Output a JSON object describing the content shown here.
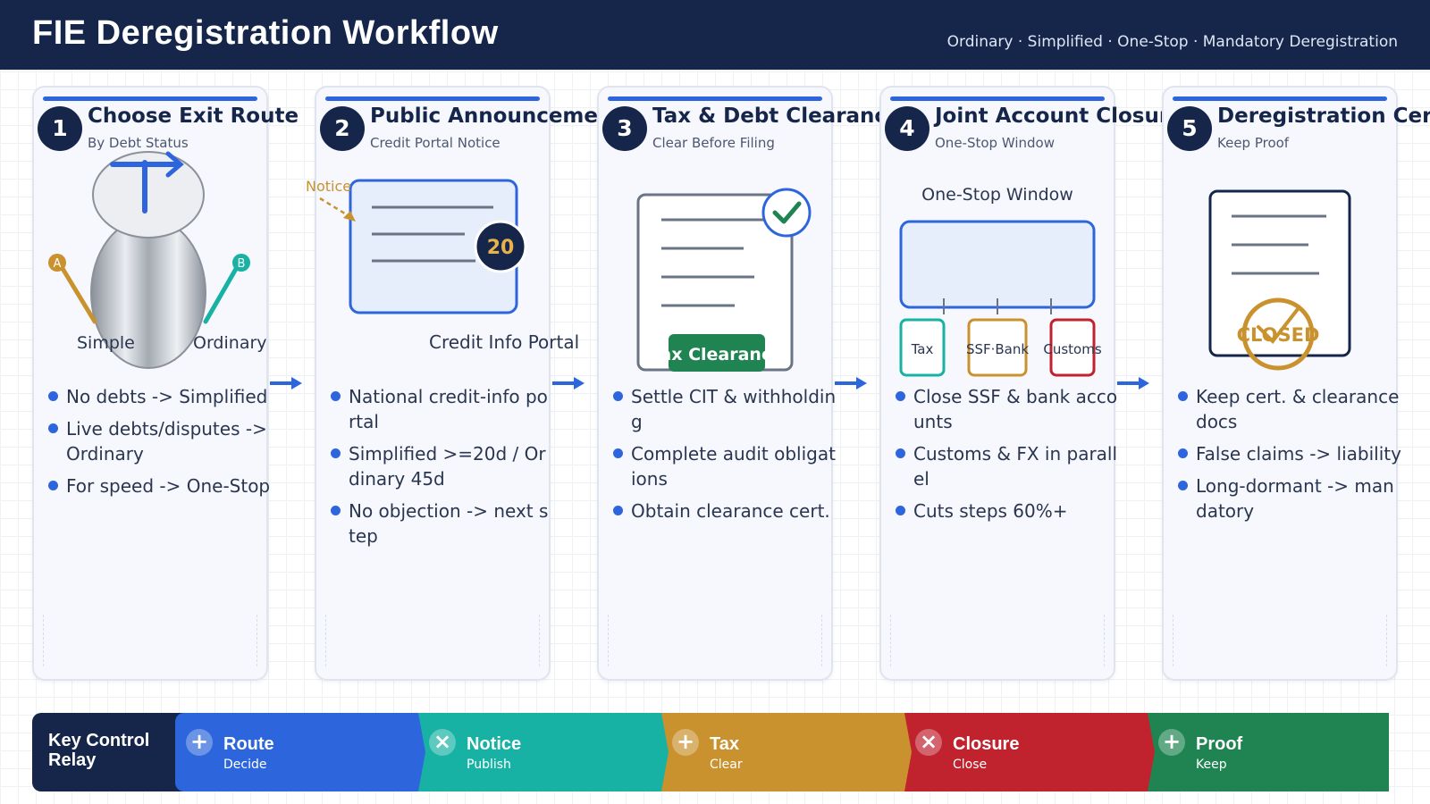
{
  "header": {
    "title": "FIE Deregistration Workflow",
    "subtitle": "Ordinary · Simplified · One-Stop · Mandatory Deregistration"
  },
  "steps": [
    {
      "num": "1",
      "title": "Choose Exit Route",
      "sub": "By Debt Status",
      "illus": {
        "badge_a": "A",
        "badge_b": "B",
        "left": "Simple",
        "right": "Ordinary"
      },
      "bullets": [
        "No debts -> Simplified",
        "Live debts/disputes -> Ordinary",
        "For speed -> One-Stop"
      ]
    },
    {
      "num": "2",
      "title": "Public Announcement",
      "sub": "Credit Portal Notice",
      "illus": {
        "notice": "Notice",
        "days": "20",
        "caption": "Credit Info Portal"
      },
      "bullets": [
        "National credit-info portal",
        "Simplified >=20d / Ordinary 45d",
        "No objection -> next step"
      ]
    },
    {
      "num": "3",
      "title": "Tax & Debt Clearance",
      "sub": "Clear Before Filing",
      "illus": {
        "stamp": "Tax Clearance"
      },
      "bullets": [
        "Settle CIT & withholding",
        "Complete audit obligations",
        "Obtain clearance cert."
      ]
    },
    {
      "num": "4",
      "title": "Joint Account Closure",
      "sub": "One-Stop Window",
      "illus": {
        "window_label": "One-Stop Window",
        "boxes": [
          "Tax",
          "SSF·Bank",
          "Customs"
        ]
      },
      "bullets": [
        "Close SSF & bank accounts",
        "Customs & FX in parallel",
        "Cuts steps 60%+"
      ]
    },
    {
      "num": "5",
      "title": "Deregistration Cert.",
      "sub": "Keep Proof",
      "illus": {
        "stamp": "CLOSED"
      },
      "bullets": [
        "Keep cert. & clearance docs",
        "False claims -> liability",
        "Long-dormant -> mandatory"
      ]
    }
  ],
  "relay": {
    "title_line1": "Key Control",
    "title_line2": "Relay",
    "segments": [
      {
        "icon": "+",
        "label": "Route",
        "sub": "Decide",
        "color": "#2d66dc"
      },
      {
        "icon": "×",
        "label": "Notice",
        "sub": "Publish",
        "color": "#17b2a4"
      },
      {
        "icon": "+",
        "label": "Tax",
        "sub": "Clear",
        "color": "#c9922e"
      },
      {
        "icon": "×",
        "label": "Closure",
        "sub": "Close",
        "color": "#c0222e"
      },
      {
        "icon": "+",
        "label": "Proof",
        "sub": "Keep",
        "color": "#1f8452"
      }
    ]
  },
  "colors": {
    "navy": "#16264a",
    "blue": "#2d66dc",
    "teal": "#17b2a4",
    "gold": "#c9922e",
    "red": "#c0222e",
    "green": "#1f8452"
  }
}
